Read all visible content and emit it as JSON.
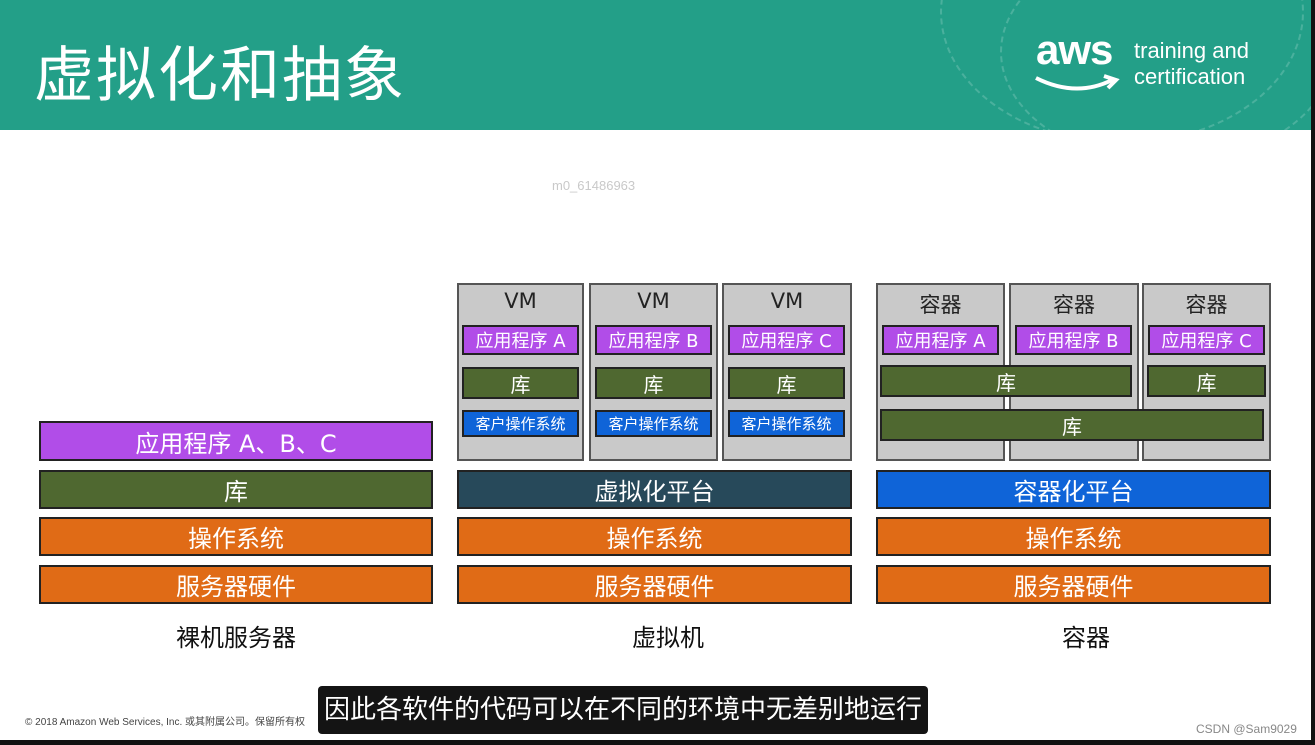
{
  "slide": {
    "title": "虚拟化和抽象",
    "logo": {
      "brand": "aws",
      "line1": "training and",
      "line2": "certification"
    },
    "watermark": "m0_61486963"
  },
  "columns": {
    "bare_metal": {
      "label": "裸机服务器",
      "app": "应用程序 A、B、C",
      "lib": "库",
      "os": "操作系统",
      "hw": "服务器硬件"
    },
    "vm": {
      "label": "虚拟机",
      "platform": "虚拟化平台",
      "os": "操作系统",
      "hw": "服务器硬件",
      "boxes": [
        {
          "title": "VM",
          "app": "应用程序 A",
          "lib": "库",
          "guest_os": "客户操作系统"
        },
        {
          "title": "VM",
          "app": "应用程序 B",
          "lib": "库",
          "guest_os": "客户操作系统"
        },
        {
          "title": "VM",
          "app": "应用程序 C",
          "lib": "库",
          "guest_os": "客户操作系统"
        }
      ]
    },
    "container": {
      "label": "容器",
      "platform": "容器化平台",
      "os": "操作系统",
      "hw": "服务器硬件",
      "boxes": [
        {
          "title": "容器",
          "app": "应用程序 A"
        },
        {
          "title": "容器",
          "app": "应用程序 B"
        },
        {
          "title": "容器",
          "app": "应用程序 C"
        }
      ],
      "shared_lib_ab": "库",
      "lib_c": "库",
      "shared_lib_all": "库"
    }
  },
  "footer": {
    "copyright": "© 2018 Amazon Web Services, Inc. 或其附属公司。保留所有权",
    "subtitle": "因此各软件的代码可以在不同的环境中无差别地运行",
    "csdn": "CSDN @Sam9029"
  },
  "colors": {
    "header": "#239f88",
    "app": "#b14de8",
    "library": "#4f6830",
    "os_hw": "#e06b16",
    "virtualization": "#27495a",
    "containerization": "#0f64d8"
  }
}
